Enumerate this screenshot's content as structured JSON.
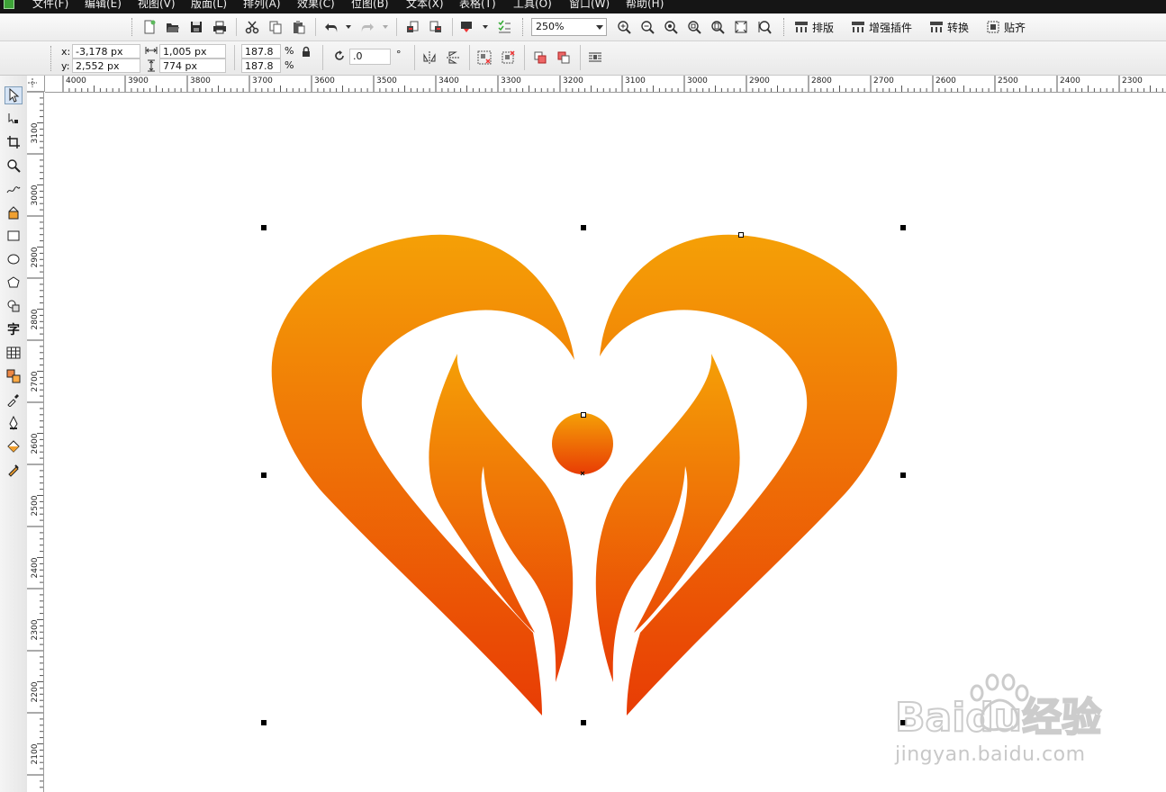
{
  "menubar": {
    "items": [
      "文件(F)",
      "编辑(E)",
      "视图(V)",
      "版面(L)",
      "排列(A)",
      "效果(C)",
      "位图(B)",
      "文本(X)",
      "表格(T)",
      "工具(O)",
      "窗口(W)",
      "帮助(H)"
    ]
  },
  "toolbar": {
    "zoom_value": "250%",
    "plugin_labels": [
      "排版",
      "增强插件",
      "转换",
      "贴齐"
    ]
  },
  "propertybar": {
    "x_label": "x:",
    "x_value": "-3,178 px",
    "y_label": "y:",
    "y_value": "2,552 px",
    "width_value": "1,005 px",
    "height_value": "774 px",
    "scale_x": "187.8",
    "scale_y": "187.8",
    "percent": "%",
    "rotation_value": ".0",
    "degree": "°"
  },
  "ruler": {
    "horizontal_labels": [
      "4000",
      "3900",
      "3800",
      "3700",
      "3600",
      "3500",
      "3400",
      "3300",
      "3200",
      "3100",
      "3000",
      "2900",
      "2800",
      "2700",
      "2600",
      "2500",
      "2400",
      "2300"
    ],
    "vertical_labels": [
      "3100",
      "3000",
      "2900",
      "2800",
      "2700",
      "2600",
      "2500",
      "2400",
      "2300",
      "2200",
      "2100"
    ]
  },
  "toolbox": {
    "text_tool_glyph": "字"
  },
  "artwork": {
    "gradient_top": "#f5a006",
    "gradient_bottom": "#e83c05"
  },
  "watermark": {
    "brand_text": "Baidu经验",
    "url_text": "jingyan.baidu.com"
  }
}
